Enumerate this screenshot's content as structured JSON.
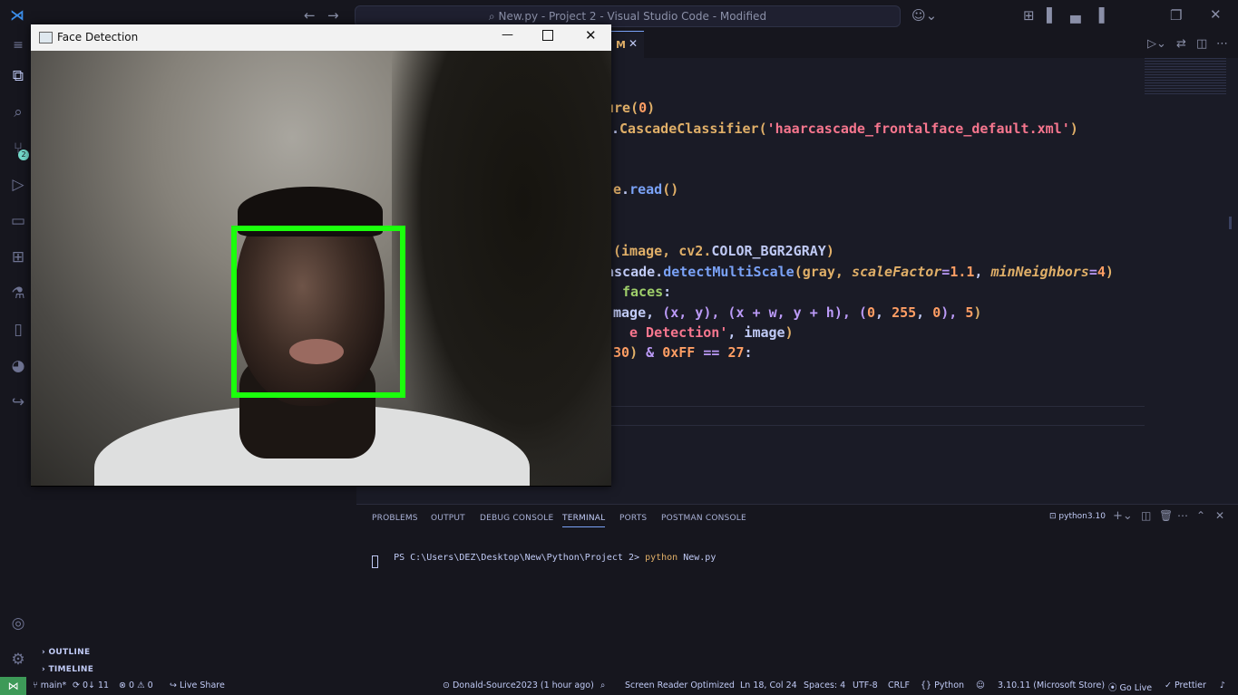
{
  "titlebar": {
    "command_center": "New.py - Project 2 - Visual Studio Code - Modified"
  },
  "face_window": {
    "title": "Face Detection",
    "box_color": "#1bff0c"
  },
  "editor": {
    "tab_fragment": "M",
    "lines": [
      {
        "parts": [
          {
            "t": "ure",
            "c": "f"
          },
          {
            "t": "(",
            "c": "f"
          },
          {
            "t": "0",
            "c": "n"
          },
          {
            "t": ")",
            "c": "f"
          }
        ]
      },
      {
        "parts": [
          {
            "t": ".",
            "c": ""
          },
          {
            "t": "CascadeClassifier",
            "c": "f"
          },
          {
            "t": "(",
            "c": "f"
          },
          {
            "t": "'haarcascade_frontalface_default.xml'",
            "c": "s"
          },
          {
            "t": ")",
            "c": "f"
          }
        ]
      },
      {
        "parts": [
          {
            "t": "e",
            "c": "f"
          },
          {
            "t": ".",
            "c": ""
          },
          {
            "t": "read",
            "c": "m"
          },
          {
            "t": "()",
            "c": "f"
          }
        ]
      },
      {
        "parts": [
          {
            "t": "(image, cv2.",
            "c": "f"
          },
          {
            "t": "COLOR_BGR2GRAY",
            "c": ""
          },
          {
            "t": ")",
            "c": "f"
          }
        ]
      },
      {
        "parts": [
          {
            "t": "ascade.",
            "c": ""
          },
          {
            "t": "detectMultiScale",
            "c": "m"
          },
          {
            "t": "(gray, ",
            "c": "f"
          },
          {
            "t": "scaleFactor",
            "c": "i"
          },
          {
            "t": "=",
            "c": "k"
          },
          {
            "t": "1.1",
            "c": "n"
          },
          {
            "t": ", ",
            "c": ""
          },
          {
            "t": "minNeighbors",
            "c": "i"
          },
          {
            "t": "=",
            "c": "k"
          },
          {
            "t": "4",
            "c": "n"
          },
          {
            "t": ")",
            "c": "f"
          }
        ]
      },
      {
        "parts": [
          {
            "t": "faces",
            "c": "g"
          },
          {
            "t": ":",
            "c": ""
          }
        ]
      },
      {
        "parts": [
          {
            "t": "mage, ",
            "c": ""
          },
          {
            "t": "(x, y), (x ",
            "c": "k"
          },
          {
            "t": "+",
            "c": "k"
          },
          {
            "t": " w, y ",
            "c": "k"
          },
          {
            "t": "+",
            "c": "k"
          },
          {
            "t": " h), (",
            "c": "k"
          },
          {
            "t": "0",
            "c": "n"
          },
          {
            "t": ", ",
            "c": ""
          },
          {
            "t": "255",
            "c": "n"
          },
          {
            "t": ", ",
            "c": ""
          },
          {
            "t": "0",
            "c": "n"
          },
          {
            "t": "), ",
            "c": "k"
          },
          {
            "t": "5",
            "c": "n"
          },
          {
            "t": ")",
            "c": "f"
          }
        ]
      },
      {
        "parts": [
          {
            "t": "e Detection'",
            "c": "s"
          },
          {
            "t": ", image",
            "c": ""
          },
          {
            "t": ")",
            "c": "f"
          }
        ]
      },
      {
        "parts": [
          {
            "t": "30",
            "c": "n"
          },
          {
            "t": ") ",
            "c": "f"
          },
          {
            "t": "& ",
            "c": "k"
          },
          {
            "t": "0xFF",
            "c": "n"
          },
          {
            "t": " == ",
            "c": "k"
          },
          {
            "t": "27",
            "c": "n"
          },
          {
            "t": ":",
            "c": ""
          }
        ]
      }
    ]
  },
  "sidebar": {
    "outline": "OUTLINE",
    "timeline": "TIMELINE"
  },
  "activity_badge": "2",
  "panel": {
    "tabs": [
      "PROBLEMS",
      "OUTPUT",
      "DEBUG CONSOLE",
      "TERMINAL",
      "PORTS",
      "POSTMAN CONSOLE"
    ],
    "active_tab": "TERMINAL",
    "terminal_name": "python3.10",
    "prompt": "PS C:\\Users\\DEZ\\Desktop\\New\\Python\\Project 2>",
    "command_keyword": "python",
    "command_arg": "New.py"
  },
  "statusbar": {
    "branch": "main*",
    "sync": "0↓ 11",
    "errors": "0",
    "warnings": "0",
    "live_share": "Live Share",
    "blame": "Donald-Source2023 (1 hour ago)",
    "screen_reader": "Screen Reader Optimized",
    "position": "Ln 18, Col 24",
    "spaces": "Spaces: 4",
    "encoding": "UTF-8",
    "eol": "CRLF",
    "language": "Python",
    "interpreter": "3.10.11 (Microsoft Store)",
    "go_live": "Go Live",
    "prettier": "Prettier"
  }
}
